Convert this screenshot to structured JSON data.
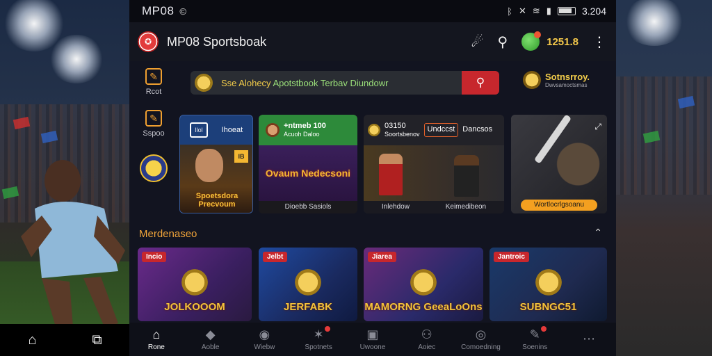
{
  "status": {
    "left_label": "MP08",
    "time": "3.204"
  },
  "app": {
    "title": "MP08 Sportsboak",
    "balance": "1251.8"
  },
  "sidenav": [
    {
      "label": "Rcot"
    },
    {
      "label": "Sspoo"
    }
  ],
  "search": {
    "text_a": "Sse Alohecy",
    "text_b": "Apotstbook Terbav Diundowr"
  },
  "promo_right": {
    "title": "Sotnsrroy.",
    "subtitle": "Dwvsamoctsmas"
  },
  "featured": {
    "c1": {
      "box": "Ilol",
      "label": "Ihoeat",
      "tag": "IB",
      "art_text": "Spoetsdora Precvoum"
    },
    "c2": {
      "head_num": "+ntmeb  100",
      "head_sub": "Acuoh      Daloo",
      "art_text": "Ovaum Nedecsoni",
      "foot": "Dioebb Sasiols"
    },
    "c3": {
      "cell1_top": "03150",
      "cell1_bot": "Soortsbenov",
      "cell2": "Undccst",
      "cell3": "Dancsos",
      "foot_left": "Inlehdow",
      "foot_right": "Keimedibeon"
    },
    "c4": {
      "pill": "Wortlocrlgsoanu"
    }
  },
  "section": {
    "title": "Merdenaseo"
  },
  "games": [
    {
      "badge": "Incio",
      "title": "JOLKOOOM"
    },
    {
      "badge": "Jelbt",
      "title": "JERFABK"
    },
    {
      "badge": "Jiarea",
      "title": "MAMORNG GeeaLoOns"
    },
    {
      "badge": "Jantroic",
      "title": "SUBNGC51"
    }
  ],
  "bottomnav": [
    {
      "label": "Rone"
    },
    {
      "label": "Aoble"
    },
    {
      "label": "Wiebw"
    },
    {
      "label": "Spotnets"
    },
    {
      "label": "Uwoone"
    },
    {
      "label": "Aoiec"
    },
    {
      "label": "Comoedning"
    },
    {
      "label": "Soenins"
    },
    {
      "label": ""
    }
  ]
}
